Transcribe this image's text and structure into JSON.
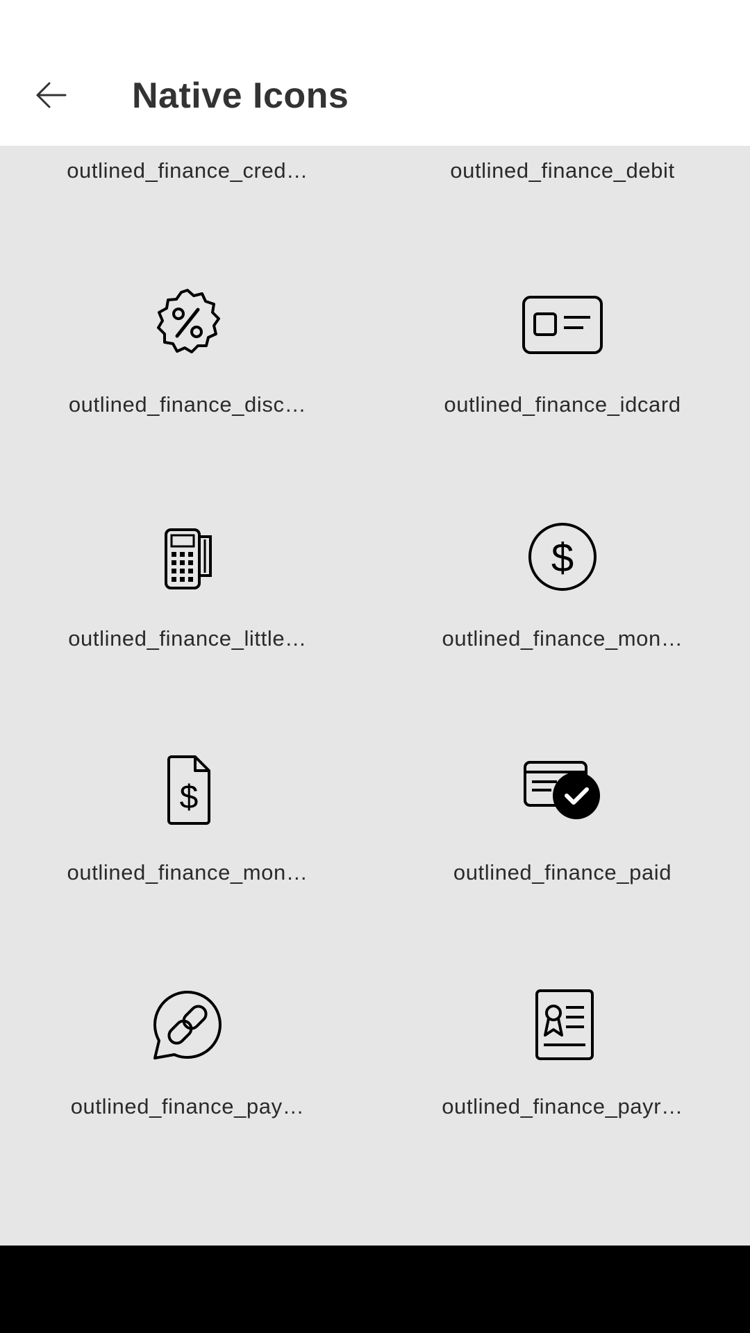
{
  "header": {
    "title": "Native Icons"
  },
  "icons": [
    {
      "label": "outlined_finance_cred…",
      "icon": "credit-card-icon"
    },
    {
      "label": "outlined_finance_debit",
      "icon": "debit-card-icon"
    },
    {
      "label": "outlined_finance_disc…",
      "icon": "discount-badge-icon"
    },
    {
      "label": "outlined_finance_idcard",
      "icon": "id-card-icon"
    },
    {
      "label": "outlined_finance_little…",
      "icon": "card-terminal-icon"
    },
    {
      "label": "outlined_finance_mon…",
      "icon": "money-circle-icon"
    },
    {
      "label": "outlined_finance_mon…",
      "icon": "money-document-icon"
    },
    {
      "label": "outlined_finance_paid",
      "icon": "paid-card-check-icon"
    },
    {
      "label": "outlined_finance_pay…",
      "icon": "payment-link-chat-icon"
    },
    {
      "label": "outlined_finance_payr…",
      "icon": "payroll-document-icon"
    }
  ]
}
